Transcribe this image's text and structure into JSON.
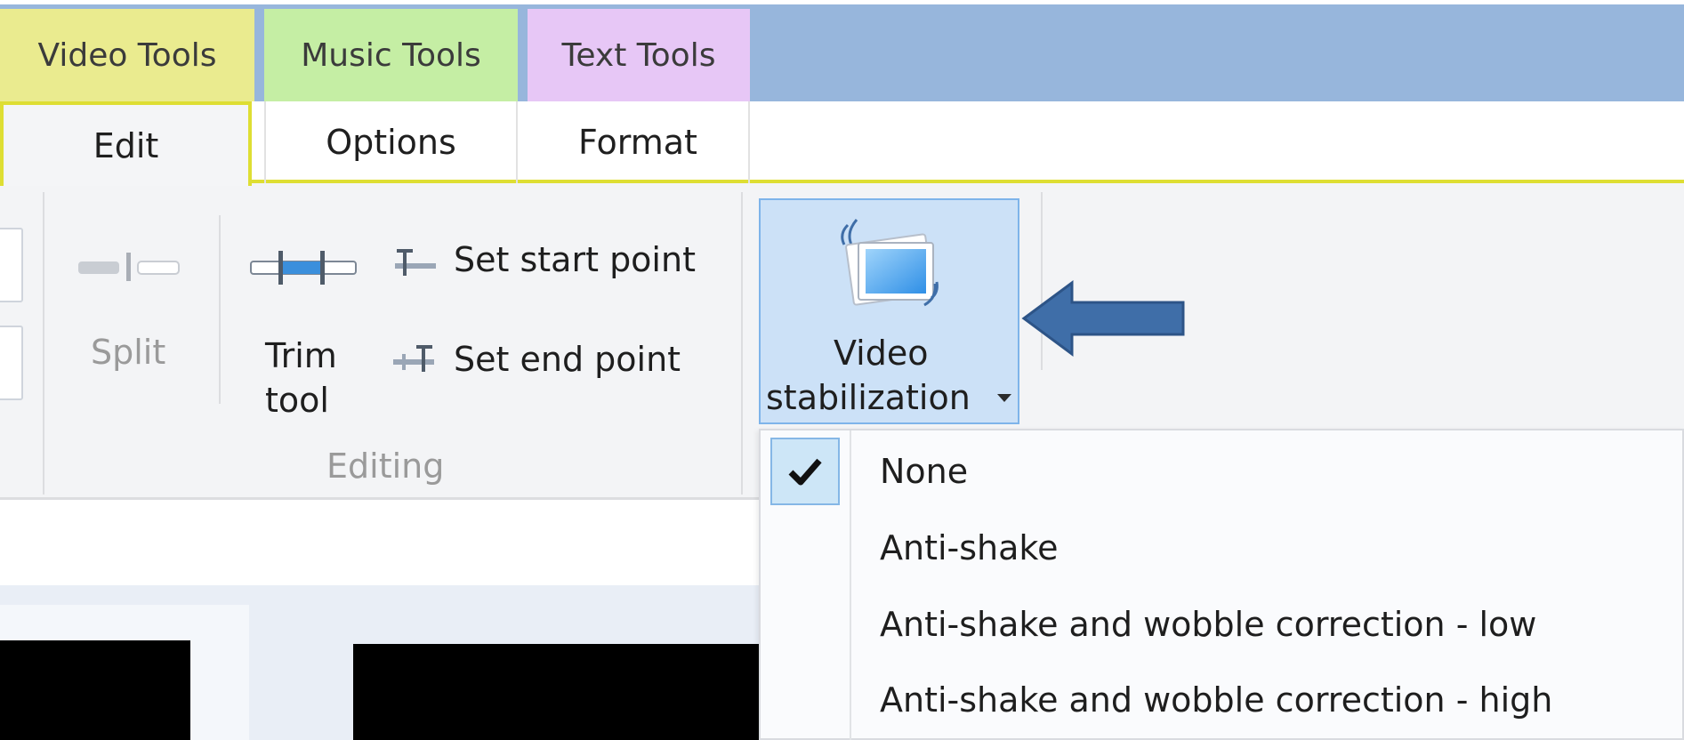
{
  "contextual_tabs": {
    "video_tools": "Video Tools",
    "music_tools": "Music Tools",
    "text_tools": "Text Tools"
  },
  "ribbon_tabs": {
    "edit": "Edit",
    "options": "Options",
    "format": "Format",
    "active": "Edit"
  },
  "editing_group": {
    "split_label": "Split",
    "trim_label_line1": "Trim",
    "trim_label_line2": "tool",
    "set_start_point": "Set start point",
    "set_end_point": "Set end point",
    "group_label": "Editing"
  },
  "video_stabilization": {
    "label_line1": "Video",
    "label_line2": "stabilization",
    "expanded": true
  },
  "stabilization_menu": {
    "items": [
      {
        "label": "None",
        "checked": true
      },
      {
        "label": "Anti-shake",
        "checked": false
      },
      {
        "label": "Anti-shake and wobble correction - low",
        "checked": false
      },
      {
        "label": "Anti-shake and wobble correction - high",
        "checked": false
      }
    ]
  },
  "colors": {
    "video_tools": "#eaeb8f",
    "music_tools": "#c5eea4",
    "text_tools": "#e7c7f6",
    "header_band": "#97b6dc",
    "highlight": "#cce1f7",
    "annotation_arrow": "#3f6ea8"
  },
  "icons": {
    "split": "split-icon",
    "trim": "trim-tool-icon",
    "set_start": "set-start-point-icon",
    "set_end": "set-end-point-icon",
    "stabilization": "video-stabilization-icon",
    "dropdown": "dropdown-triangle-icon",
    "check": "checkmark-icon",
    "annotation": "left-arrow-annotation-icon"
  }
}
